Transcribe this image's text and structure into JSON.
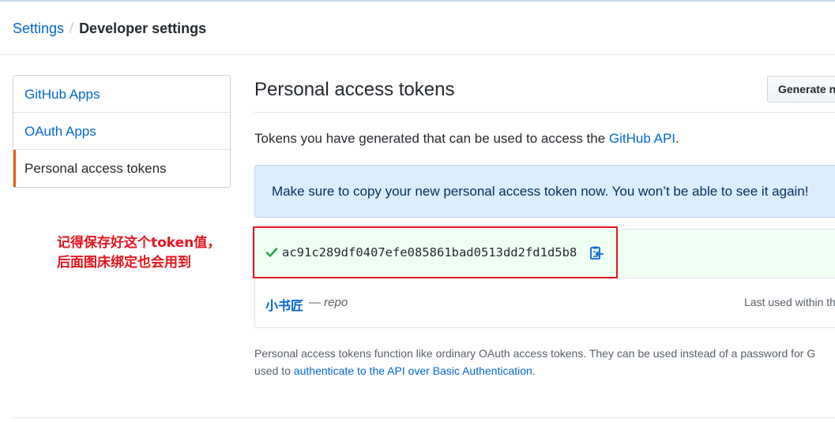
{
  "breadcrumb": {
    "parent": "Settings",
    "separator": "/",
    "current": "Developer settings"
  },
  "sidebar": {
    "items": [
      {
        "label": "GitHub Apps",
        "selected": false
      },
      {
        "label": "OAuth Apps",
        "selected": false
      },
      {
        "label": "Personal access tokens",
        "selected": true
      }
    ]
  },
  "annotation": {
    "line1": "记得保存好这个token值，",
    "line2": "后面图床绑定也会用到",
    "color": "#e5141b"
  },
  "main": {
    "title": "Personal access tokens",
    "generate_button": "Generate n",
    "description_prefix": "Tokens you have generated that can be used to access the ",
    "description_link": "GitHub API",
    "description_suffix": ".",
    "flash_message": "Make sure to copy your new personal access token now. You won’t be able to see it again!",
    "new_token": {
      "value": "ac91c289df0407efe085861bad0513dd2fd1d5b8",
      "check_icon": "check-icon",
      "copy_icon": "clippy-icon"
    },
    "token": {
      "name": "小书匠",
      "dash": "—",
      "scope": "repo",
      "last_used": "Last used within th"
    },
    "footnote_line1": "Personal access tokens function like ordinary OAuth access tokens. They can be used instead of a password for G",
    "footnote_line2_prefix": "used to ",
    "footnote_link": "authenticate to the API over Basic Authentication",
    "footnote_line2_suffix": "."
  },
  "colors": {
    "link": "#0366d6",
    "accent": "#e36209",
    "flash_bg": "#dbedff",
    "success_bg": "#f0fff4",
    "check": "#28a745"
  }
}
